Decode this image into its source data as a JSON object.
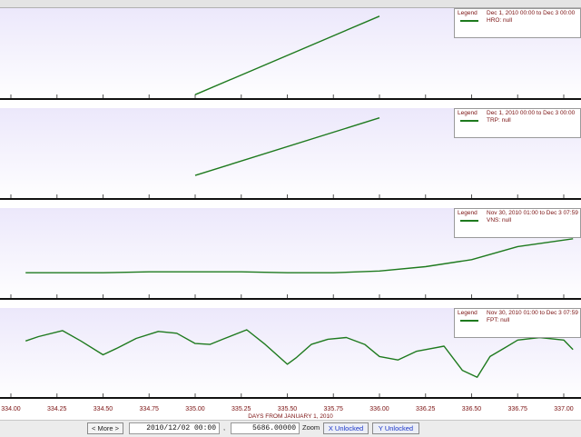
{
  "panels": [
    {
      "legend_word": "Legend",
      "range": "Dec 1, 2010 00:00 to Dec 3 00:00",
      "series": "HRO: null"
    },
    {
      "legend_word": "Legend",
      "range": "Dec 1, 2010 00:00 to Dec 3 00:00",
      "series": "TRP: null"
    },
    {
      "legend_word": "Legend",
      "range": "Nov 30, 2010 01:00 to Dec 3 07:59",
      "series": "VNS: null"
    },
    {
      "legend_word": "Legend",
      "range": "Nov 30, 2010 01:00 to Dec 3 07:59",
      "series": "FPT: null"
    }
  ],
  "chart_data": [
    {
      "type": "line",
      "series": [
        {
          "name": "HRO: null",
          "x": [
            335.0,
            336.0
          ],
          "values": [
            0.05,
            0.95
          ]
        }
      ],
      "ylim": [
        0,
        1
      ],
      "xlim": [
        334.0,
        337.05
      ],
      "title": "",
      "xlabel": "",
      "ylabel": ""
    },
    {
      "type": "line",
      "series": [
        {
          "name": "TRP: null",
          "x": [
            335.0,
            336.0
          ],
          "values": [
            0.27,
            0.93
          ]
        }
      ],
      "ylim": [
        0,
        1
      ],
      "xlim": [
        334.0,
        337.05
      ],
      "title": "",
      "xlabel": "",
      "ylabel": ""
    },
    {
      "type": "line",
      "series": [
        {
          "name": "VNS: null",
          "x": [
            334.08,
            334.5,
            334.75,
            335.0,
            335.25,
            335.5,
            335.75,
            336.0,
            336.25,
            336.5,
            336.75,
            337.05
          ],
          "values": [
            0.3,
            0.3,
            0.31,
            0.31,
            0.31,
            0.3,
            0.3,
            0.32,
            0.37,
            0.45,
            0.6,
            0.69
          ]
        }
      ],
      "ylim": [
        0,
        1
      ],
      "xlim": [
        334.0,
        337.05
      ],
      "title": "",
      "xlabel": "",
      "ylabel": ""
    },
    {
      "type": "line",
      "series": [
        {
          "name": "FPT: null",
          "x": [
            334.08,
            334.15,
            334.28,
            334.38,
            334.5,
            334.58,
            334.68,
            334.8,
            334.9,
            335.0,
            335.08,
            335.15,
            335.28,
            335.38,
            335.5,
            335.55,
            335.63,
            335.72,
            335.82,
            335.92,
            336.0,
            336.1,
            336.2,
            336.35,
            336.45,
            336.53,
            336.6,
            336.68,
            336.75,
            336.87,
            337.0,
            337.05
          ],
          "values": [
            0.66,
            0.71,
            0.78,
            0.66,
            0.5,
            0.58,
            0.69,
            0.77,
            0.75,
            0.63,
            0.62,
            0.68,
            0.79,
            0.62,
            0.39,
            0.47,
            0.62,
            0.68,
            0.7,
            0.62,
            0.48,
            0.44,
            0.54,
            0.6,
            0.32,
            0.24,
            0.48,
            0.58,
            0.67,
            0.7,
            0.67,
            0.56
          ]
        }
      ],
      "ylim": [
        0,
        1
      ],
      "xlim": [
        334.0,
        337.05
      ],
      "title": "",
      "xlabel": "",
      "ylabel": ""
    }
  ],
  "x_ticks": [
    "334.00",
    "334.25",
    "334.50",
    "334.75",
    "335.00",
    "335.25",
    "335.50",
    "335.75",
    "336.00",
    "336.25",
    "336.50",
    "336.75",
    "337.00"
  ],
  "x_tick_values": [
    334.0,
    334.25,
    334.5,
    334.75,
    335.0,
    335.25,
    335.5,
    335.75,
    336.0,
    336.25,
    336.5,
    336.75,
    337.0
  ],
  "x_title": "DAYS FROM JANUARY 1, 2010",
  "toolbar": {
    "more_label": "< More >",
    "date_value": "2010/12/02 00:00",
    "comma": ",",
    "value_value": "5686.00000",
    "zoom_label": "Zoom",
    "x_lock_label": "X Unlocked",
    "y_lock_label": "Y Unlocked"
  },
  "colors": {
    "line": "#1e7a1e",
    "plot_top": "#ece8fb",
    "plot_bottom": "#ffffff",
    "axis_text": "#7a1010"
  }
}
